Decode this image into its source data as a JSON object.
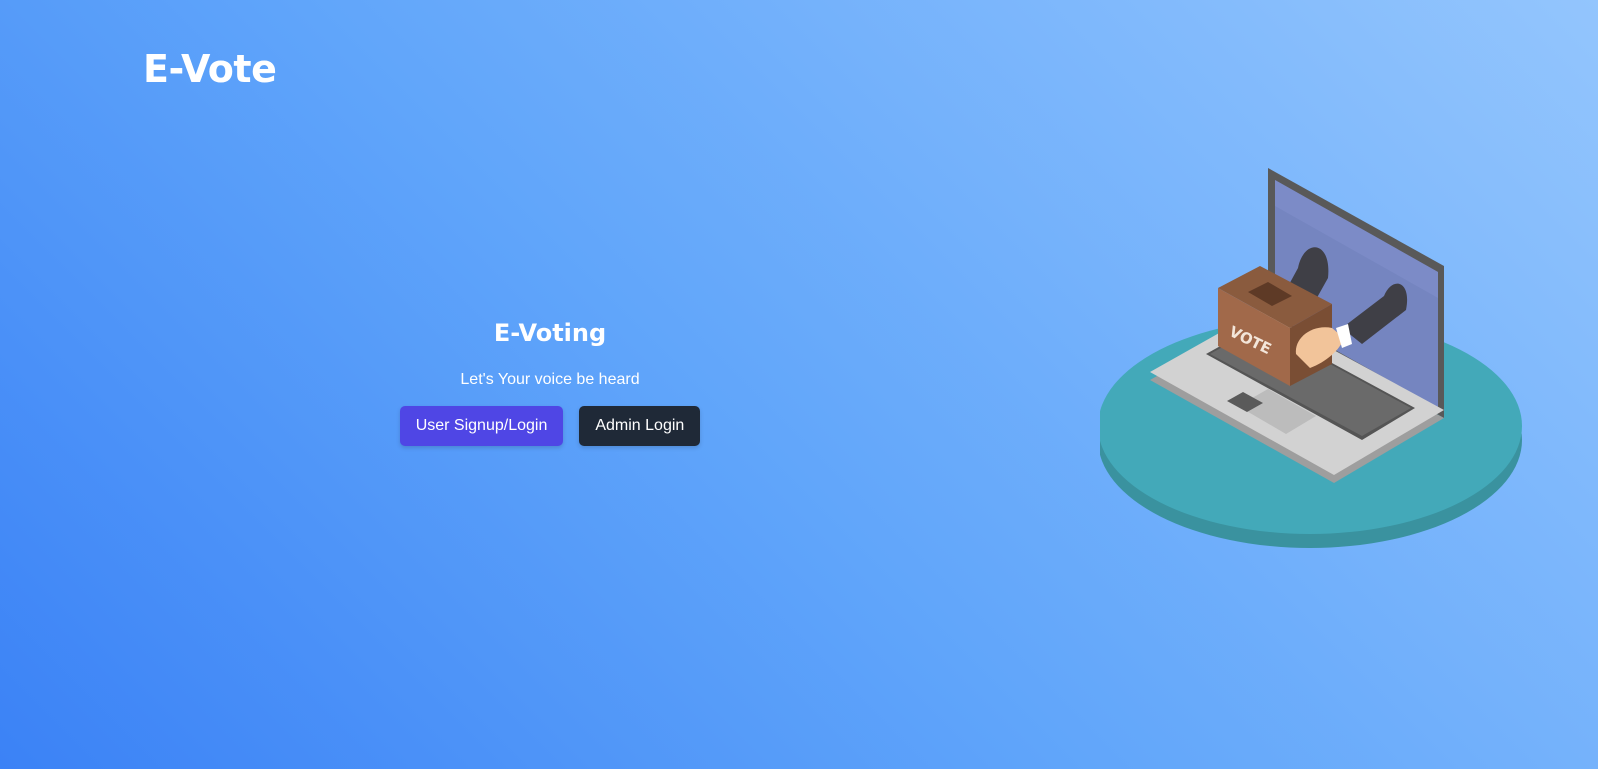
{
  "header": {
    "brand": "E-Vote"
  },
  "hero": {
    "title": "E-Voting",
    "subtitle": "Let's Your voice be heard",
    "user_button_label": "User Signup/Login",
    "admin_button_label": "Admin Login"
  },
  "illustration": {
    "box_label": "VOTE",
    "icon": "laptop-ballot-box-illustration"
  },
  "colors": {
    "background_start": "#3b82f6",
    "background_end": "#93c5fd",
    "user_button": "#4f46e5",
    "admin_button": "#1f2937",
    "platform": "#40a8b8"
  }
}
